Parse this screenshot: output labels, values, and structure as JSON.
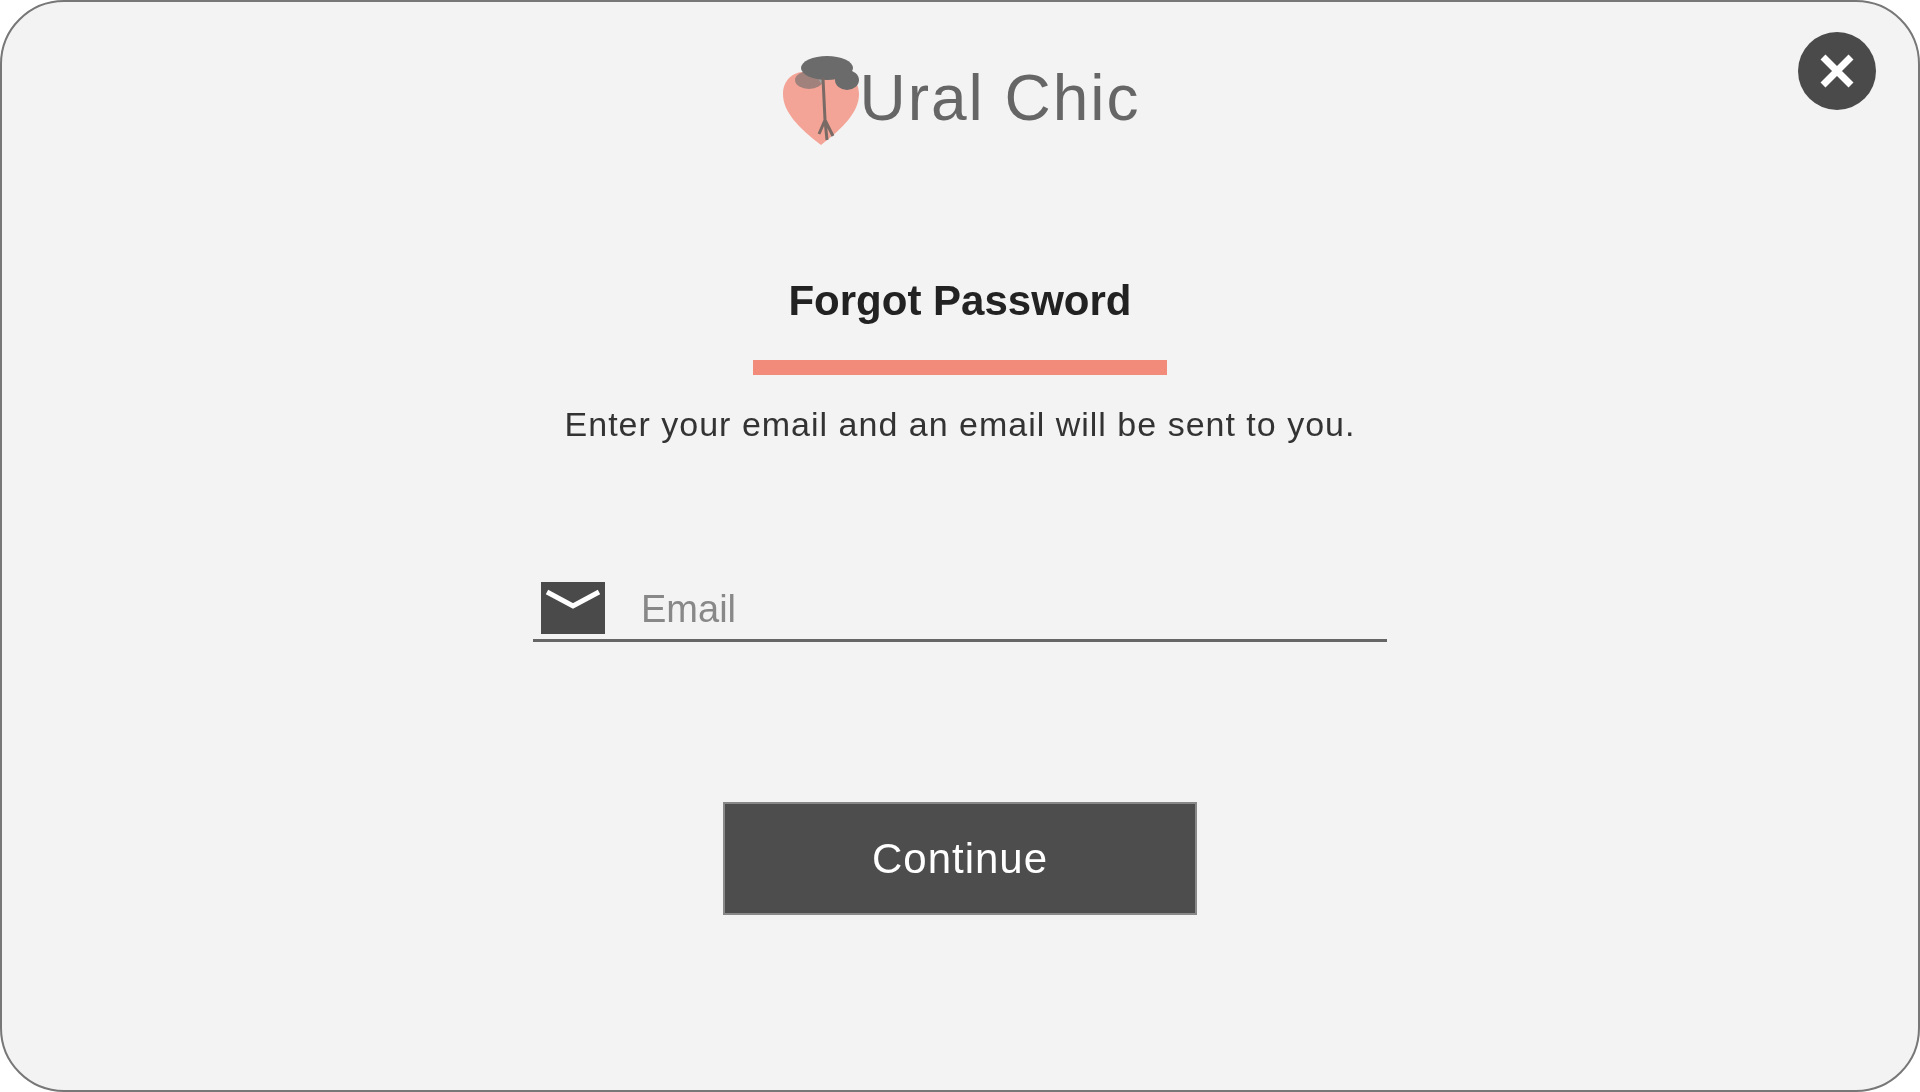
{
  "logo": {
    "text": "Ural Chic"
  },
  "dialog": {
    "title": "Forgot Password",
    "subtitle": "Enter your email and an email will be sent to you."
  },
  "email_field": {
    "placeholder": "Email"
  },
  "buttons": [
    "Continue"
  ]
}
